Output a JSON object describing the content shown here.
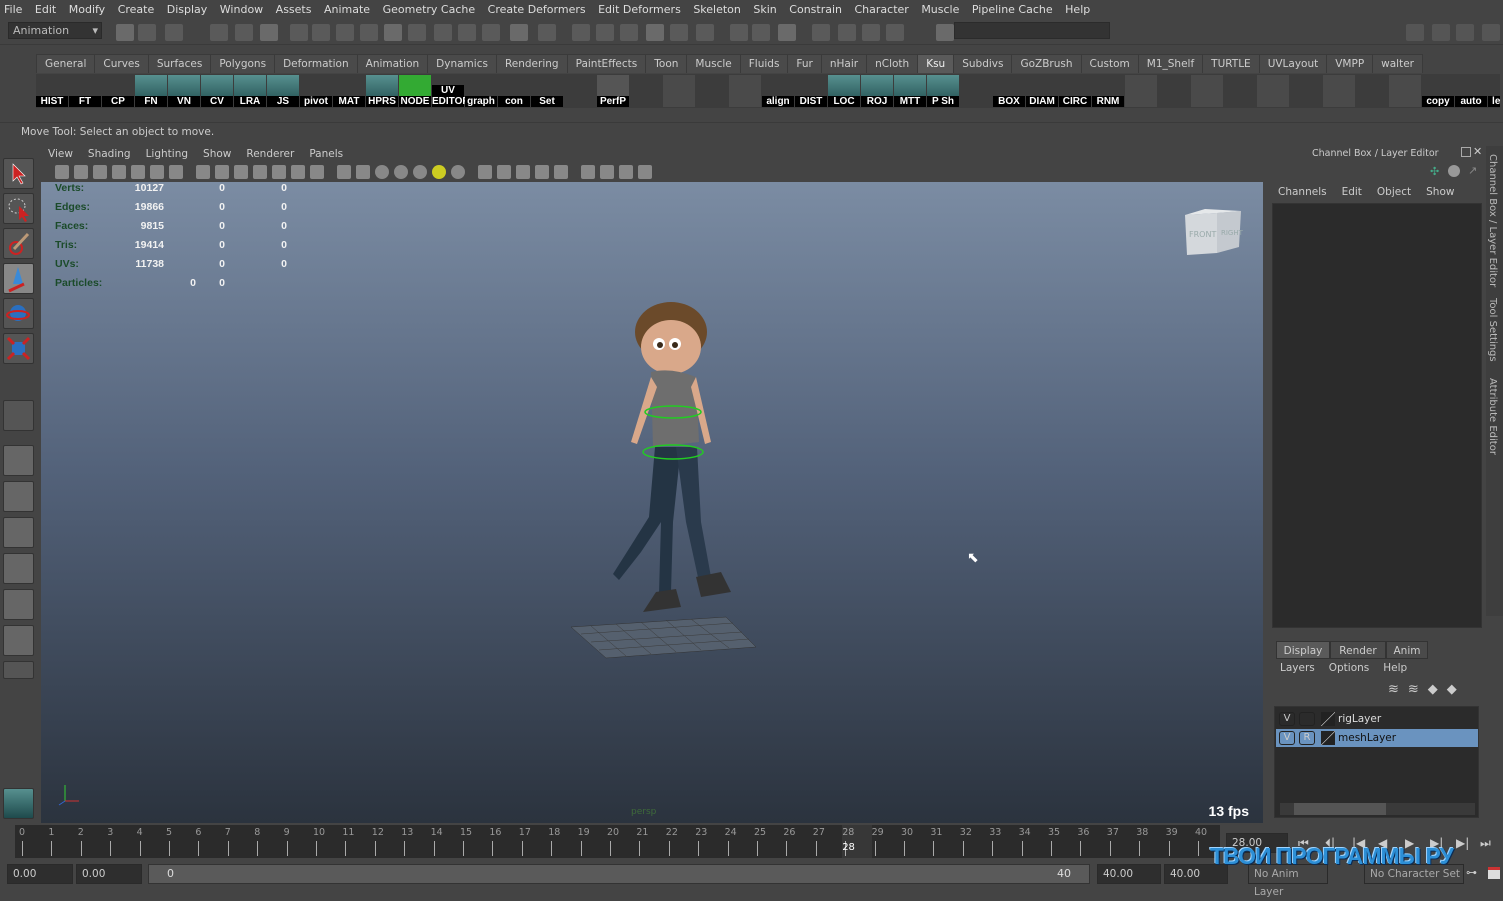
{
  "menu": [
    "File",
    "Edit",
    "Modify",
    "Create",
    "Display",
    "Window",
    "Assets",
    "Animate",
    "Geometry Cache",
    "Create Deformers",
    "Edit Deformers",
    "Skeleton",
    "Skin",
    "Constrain",
    "Character",
    "Muscle",
    "Pipeline Cache",
    "Help"
  ],
  "status": {
    "mode": "Animation",
    "command_field": ""
  },
  "shelf": {
    "tabs": [
      "General",
      "Curves",
      "Surfaces",
      "Polygons",
      "Deformation",
      "Animation",
      "Dynamics",
      "Rendering",
      "PaintEffects",
      "Toon",
      "Muscle",
      "Fluids",
      "Fur",
      "nHair",
      "nCloth",
      "Ksu",
      "Subdivs",
      "GoZBrush",
      "Custom",
      "M1_Shelf",
      "TURTLE",
      "UVLayout",
      "VMPP",
      "walter"
    ],
    "active_tab": "Ksu",
    "icons": [
      "HIST",
      "FT",
      "CP",
      "FN",
      "VN",
      "CV",
      "LRA",
      "JS",
      "pivot",
      "MAT",
      "HPRS",
      "NODE",
      "UV EDITOR",
      "graph",
      "con",
      "Set",
      "",
      "PerfP",
      "",
      "",
      "",
      "",
      "align",
      "DIST",
      "LOC",
      "ROJ",
      "MTT",
      "P Sh",
      "",
      "BOX",
      "DIAM",
      "CIRC",
      "RNM",
      "",
      "",
      "",
      "",
      "",
      "",
      "",
      "",
      "",
      "copy",
      "auto",
      "lengt",
      "",
      ""
    ]
  },
  "help_line": "Move Tool: Select an object to move.",
  "viewport": {
    "menu": [
      "View",
      "Shading",
      "Lighting",
      "Show",
      "Renderer",
      "Panels"
    ],
    "hud": [
      {
        "label": "Verts:",
        "values": [
          "10127",
          "0",
          "0"
        ]
      },
      {
        "label": "Edges:",
        "values": [
          "19866",
          "0",
          "0"
        ]
      },
      {
        "label": "Faces:",
        "values": [
          "9815",
          "0",
          "0"
        ]
      },
      {
        "label": "Tris:",
        "values": [
          "19414",
          "0",
          "0"
        ]
      },
      {
        "label": "UVs:",
        "values": [
          "11738",
          "0",
          "0"
        ]
      }
    ],
    "particles": {
      "label": "Particles:",
      "values": [
        "0",
        "0"
      ]
    },
    "viewcube": {
      "front": "FRONT",
      "right": "RIGHT"
    },
    "camera": "persp",
    "fps": "13 fps"
  },
  "channel_box": {
    "title": "Channel Box / Layer Editor",
    "menu": [
      "Channels",
      "Edit",
      "Object",
      "Show"
    ]
  },
  "side_tabs": [
    "Channel Box / Layer Editor",
    "Tool Settings",
    "Attribute Editor"
  ],
  "layer_editor": {
    "tabs": [
      "Display",
      "Render",
      "Anim"
    ],
    "active_tab": "Display",
    "menu": [
      "Layers",
      "Options",
      "Help"
    ],
    "layers": [
      {
        "name": "rigLayer",
        "v": "V",
        "r": "",
        "selected": false
      },
      {
        "name": "meshLayer",
        "v": "V",
        "r": "R",
        "selected": true
      }
    ]
  },
  "timeline": {
    "start": 0,
    "end": 40,
    "current_frame": "28",
    "current_time": "28.00"
  },
  "range": {
    "anim_start": "0.00",
    "range_start": "0.00",
    "slider_start": "0",
    "slider_end": "40",
    "range_end": "40.00",
    "anim_end": "40.00",
    "anim_layer": "No Anim Layer",
    "character_set": "No Character Set"
  },
  "watermark": "ТВОИ ПРОГРАММЫ РУ",
  "colors": {
    "selection": "#6a93bf",
    "viewport_top": "#7b8ca3",
    "viewport_bottom": "#2b333e"
  }
}
